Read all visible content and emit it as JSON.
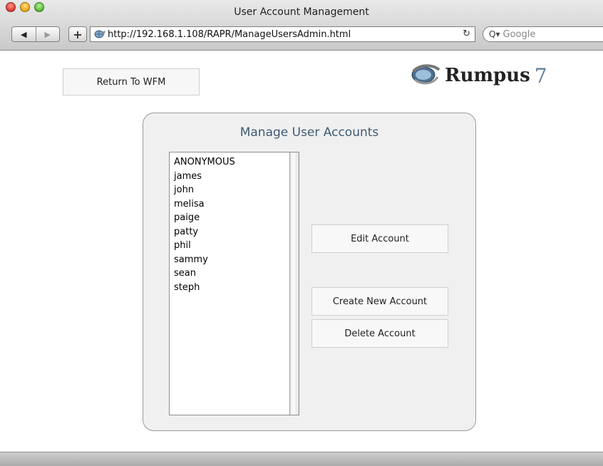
{
  "window": {
    "title": "User Account Management"
  },
  "toolbar": {
    "back_glyph": "◀",
    "forward_glyph": "▶",
    "add_glyph": "+",
    "url": "http://192.168.1.108/RAPR/ManageUsersAdmin.html",
    "reload_glyph": "↻",
    "search_icon_glyph": "Q▾",
    "search_placeholder": "Google"
  },
  "page": {
    "return_button": "Return To WFM",
    "logo": {
      "name": "Rumpus",
      "version": "7"
    },
    "panel": {
      "title": "Manage User Accounts",
      "users": [
        "ANONYMOUS",
        "james",
        "john",
        "melisa",
        "paige",
        "patty",
        "phil",
        "sammy",
        "sean",
        "steph"
      ],
      "edit_button": "Edit Account",
      "create_button": "Create New Account",
      "delete_button": "Delete Account"
    }
  },
  "colors": {
    "panel_title": "#3f5b74",
    "logo_number": "#5e7c97",
    "panel_bg": "#f0f0f0"
  },
  "icons": [
    "close-icon",
    "minimize-icon",
    "zoom-icon",
    "back-icon",
    "forward-icon",
    "add-bookmark-icon",
    "globe-icon",
    "reload-icon",
    "search-icon",
    "rumpus-logo-icon"
  ]
}
